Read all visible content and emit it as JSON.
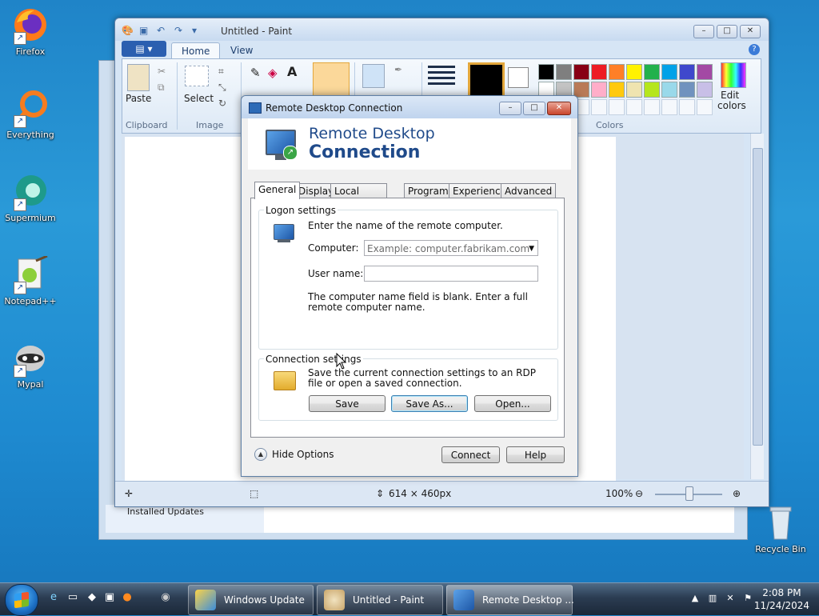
{
  "desktop": {
    "icons": [
      {
        "label": "Firefox",
        "icon": "firefox-icon"
      },
      {
        "label": "Everything",
        "icon": "everything-icon"
      },
      {
        "label": "Supermium",
        "icon": "supermium-icon"
      },
      {
        "label": "Notepad++",
        "icon": "notepadpp-icon"
      },
      {
        "label": "Mypal",
        "icon": "mypal-icon"
      }
    ],
    "recycle_bin": "Recycle Bin"
  },
  "background_window": {
    "visible_text": "Installed Updates"
  },
  "paint": {
    "title": "Untitled - Paint",
    "tabs": [
      "Home",
      "View"
    ],
    "groups": {
      "clipboard": "Clipboard",
      "image": "Image",
      "colors": "Colors"
    },
    "tools": {
      "paste": "Paste",
      "select": "Select",
      "edit_colors_line1": "Edit",
      "edit_colors_line2": "colors"
    },
    "status": {
      "dimensions": "614 × 460px",
      "zoom": "100%"
    },
    "zoom_level": 1.0,
    "palette_row1": [
      "#000000",
      "#7f7f7f",
      "#880015",
      "#ed1c24",
      "#ff7f27",
      "#fff200",
      "#22b14c",
      "#00a2e8",
      "#3f48cc",
      "#a349a4"
    ],
    "palette_row2": [
      "#ffffff",
      "#c3c3c3",
      "#b97a57",
      "#ffaec9",
      "#ffc90e",
      "#efe4b0",
      "#b5e61d",
      "#99d9ea",
      "#7092be",
      "#c8bfe7"
    ],
    "color1": "#000000",
    "color2": "#ffffff"
  },
  "rdp": {
    "window_title": "Remote Desktop Connection",
    "banner_line1": "Remote Desktop",
    "banner_line2": "Connection",
    "tabs": [
      "General",
      "Display",
      "Local Resources",
      "Programs",
      "Experience",
      "Advanced"
    ],
    "logon": {
      "title": "Logon settings",
      "instruction": "Enter the name of the remote computer.",
      "computer_label": "Computer:",
      "computer_placeholder": "Example: computer.fabrikam.com",
      "username_label": "User name:",
      "username_value": "",
      "warning": "The computer name field is blank. Enter a full remote computer name."
    },
    "connection": {
      "title": "Connection settings",
      "description": "Save the current connection settings to an RDP file or open a saved connection.",
      "save": "Save",
      "save_as": "Save As...",
      "open": "Open..."
    },
    "hide_options": "Hide Options",
    "connect": "Connect",
    "help": "Help"
  },
  "taskbar": {
    "tasks": [
      "Windows Update",
      "Untitled - Paint",
      "Remote Desktop ..."
    ],
    "time": "2:08 PM",
    "date": "11/24/2024"
  }
}
